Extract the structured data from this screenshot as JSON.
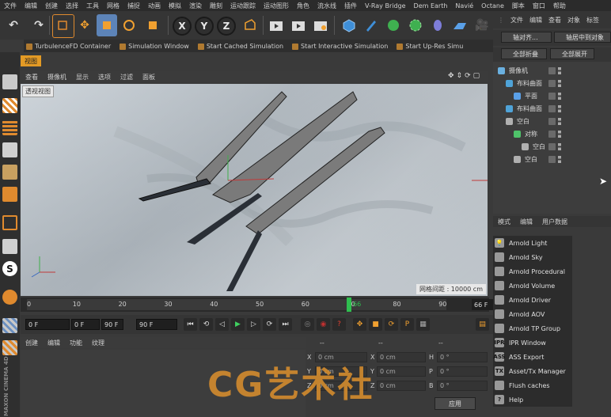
{
  "menubar": [
    "文件",
    "编辑",
    "创建",
    "选择",
    "工具",
    "网格",
    "捕捉",
    "动画",
    "模拟",
    "渲染",
    "雕刻",
    "运动跟踪",
    "运动图形",
    "角色",
    "流水线",
    "插件",
    "V-Ray Bridge",
    "Dem Earth",
    "Navié",
    "Octane",
    "脚本",
    "窗口",
    "帮助"
  ],
  "toolbar": {
    "x_label": "X",
    "y_label": "Y",
    "z_label": "Z"
  },
  "plugins": [
    "TurbulenceFD Container",
    "Simulation Window",
    "Start Cached Simulation",
    "Start Interactive Simulation",
    "Start Up-Res Simu"
  ],
  "view": {
    "tab": "视图",
    "menu": [
      "查看",
      "摄像机",
      "显示",
      "选项",
      "过滤",
      "面板"
    ],
    "label": "透视视图",
    "grid_spacing": "网格间距 : 10000 cm"
  },
  "timeline": {
    "ticks": [
      "0",
      "10",
      "20",
      "30",
      "40",
      "50",
      "60",
      "70",
      "80",
      "90"
    ],
    "current": "66",
    "end_frame": "66 F"
  },
  "transport": {
    "start": "0 F",
    "range_min": "0 F",
    "range_max": "90 F",
    "end": "90 F"
  },
  "material_menu": [
    "创建",
    "编辑",
    "功能",
    "纹理"
  ],
  "coords": {
    "header_a": "--",
    "header_b": "--",
    "header_c": "--",
    "rows": [
      {
        "l": "X",
        "v1": "0 cm",
        "m": "X",
        "v2": "0 cm",
        "r": "H",
        "v3": "0 °"
      },
      {
        "l": "Y",
        "v1": "0 cm",
        "m": "Y",
        "v2": "0 cm",
        "r": "P",
        "v3": "0 °"
      },
      {
        "l": "Z",
        "v1": "0 cm",
        "m": "Z",
        "v2": "0 cm",
        "r": "B",
        "v3": "0 °"
      }
    ],
    "apply": "应用"
  },
  "watermark": "CG艺术社",
  "maxon": "MAXON CINEMA 4D",
  "object_manager": {
    "menu": [
      "文件",
      "编辑",
      "查看",
      "对象",
      "标签"
    ],
    "btn_align": "轴对齐...",
    "btn_center": "轴居中到对象",
    "btn_collapse": "全部折叠",
    "btn_expand": "全部展开",
    "objects": [
      {
        "name": "摄像机",
        "indent": 0,
        "color": "#6ab0e0"
      },
      {
        "name": "布料曲面",
        "indent": 1,
        "color": "#4fa3d8"
      },
      {
        "name": "平面",
        "indent": 2,
        "color": "#5aa0e8"
      },
      {
        "name": "布料曲面",
        "indent": 1,
        "color": "#4fa3d8"
      },
      {
        "name": "空白",
        "indent": 1,
        "color": "#b0b0b0"
      },
      {
        "name": "对称",
        "indent": 2,
        "color": "#4fc36a"
      },
      {
        "name": "空白",
        "indent": 3,
        "color": "#b0b0b0"
      },
      {
        "name": "空白",
        "indent": 2,
        "color": "#b0b0b0"
      }
    ]
  },
  "attr_menu": [
    "模式",
    "编辑",
    "用户数据"
  ],
  "arnold_menu": [
    {
      "icon": "lightbulb-icon",
      "glyph": "💡",
      "label": "Arnold Light"
    },
    {
      "icon": "sky-icon",
      "glyph": "",
      "label": "Arnold Sky"
    },
    {
      "icon": "procedural-icon",
      "glyph": "",
      "label": "Arnold Procedural"
    },
    {
      "icon": "volume-icon",
      "glyph": "",
      "label": "Arnold Volume"
    },
    {
      "icon": "driver-icon",
      "glyph": "",
      "label": "Arnold Driver"
    },
    {
      "icon": "aov-icon",
      "glyph": "",
      "label": "Arnold AOV"
    },
    {
      "icon": "tp-group-icon",
      "glyph": "",
      "label": "Arnold TP Group"
    },
    {
      "icon": "ipr-icon",
      "glyph": "IPR",
      "label": "IPR Window"
    },
    {
      "icon": "ass-icon",
      "glyph": "ASS",
      "label": "ASS Export"
    },
    {
      "icon": "tx-icon",
      "glyph": "TX",
      "label": "Asset/Tx Manager"
    },
    {
      "icon": "trash-icon",
      "glyph": "",
      "label": "Flush caches"
    },
    {
      "icon": "help-icon",
      "glyph": "?",
      "label": "Help"
    }
  ]
}
